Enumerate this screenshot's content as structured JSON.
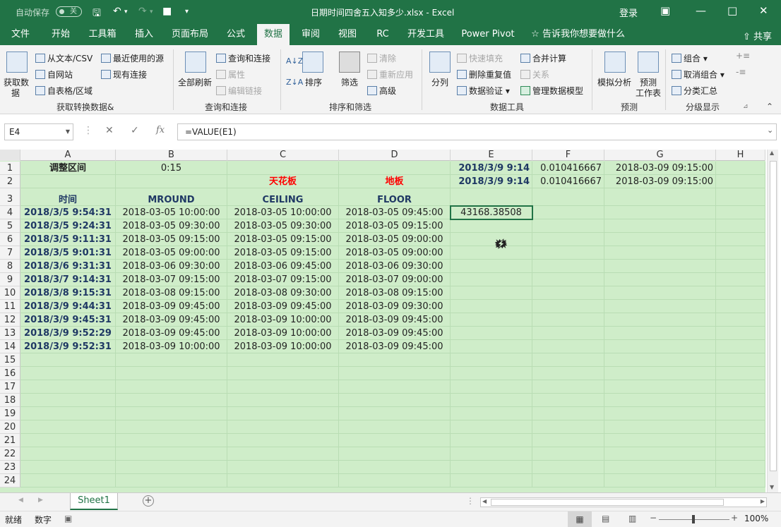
{
  "titlebar": {
    "autosave_label": "自动保存",
    "autosave_state": "关",
    "title": "日期时间四舍五入知多少.xlsx  -  Excel",
    "login": "登录"
  },
  "menu_tabs": [
    "文件",
    "开始",
    "工具箱",
    "插入",
    "页面布局",
    "公式",
    "数据",
    "审阅",
    "视图",
    "RC",
    "开发工具",
    "Power Pivot"
  ],
  "active_tab": "数据",
  "tell_me": "告诉我你想要做什么",
  "share": "共享",
  "ribbon": {
    "get_data": "获取数",
    "get_data2": "据",
    "from_text": "从文本/CSV",
    "from_web": "自网站",
    "from_table": "自表格/区域",
    "recent_sources": "最近使用的源",
    "existing_conn": "现有连接",
    "group_get": "获取转换数据&",
    "refresh_all": "全部刷新",
    "queries_conn": "查询和连接",
    "properties": "属性",
    "edit_links": "编辑链接",
    "group_query": "查询和连接",
    "sort": "排序",
    "filter": "筛选",
    "clear": "清除",
    "reapply": "重新应用",
    "advanced": "高级",
    "group_sort": "排序和筛选",
    "text_to_col": "分列",
    "flash_fill": "快速填充",
    "remove_dup": "删除重复值",
    "validation": "数据验证",
    "consolidate": "合并计算",
    "relationships": "关系",
    "manage_model": "管理数据模型",
    "group_tools": "数据工具",
    "whatif": "模拟分析",
    "forecast": "预测",
    "forecast2": "工作表",
    "group_forecast": "预测",
    "group_btn": "组合",
    "ungroup": "取消组合",
    "subtotal": "分类汇总",
    "group_outline": "分级显示"
  },
  "namebox": "E4",
  "formula": "=VALUE(E1)",
  "columns": [
    "A",
    "B",
    "C",
    "D",
    "E",
    "F",
    "G",
    "H"
  ],
  "rows": [
    "1",
    "2",
    "3",
    "4",
    "5",
    "6",
    "7",
    "8",
    "9",
    "10",
    "11",
    "12",
    "13",
    "14",
    "15",
    "16",
    "17",
    "18",
    "19",
    "20",
    "21",
    "22",
    "23",
    "24"
  ],
  "cells": {
    "A1": "调整区间",
    "B1": "0:15",
    "E1": "2018/3/9 9:14",
    "F1": "0.010416667",
    "G1": "2018-03-09 09:15:00",
    "C2": "天花板",
    "D2": "地板",
    "E2": "2018/3/9 9:14",
    "F2": "0.010416667",
    "G2": "2018-03-09 09:15:00",
    "A3": "时间",
    "B3": "MROUND",
    "C3": "CEILING",
    "D3": "FLOOR",
    "E4": "43168.38508",
    "data": [
      [
        "2018/3/5 9:54:31",
        "2018-03-05 10:00:00",
        "2018-03-05 10:00:00",
        "2018-03-05 09:45:00"
      ],
      [
        "2018/3/5 9:24:31",
        "2018-03-05 09:30:00",
        "2018-03-05 09:30:00",
        "2018-03-05 09:15:00"
      ],
      [
        "2018/3/5 9:11:31",
        "2018-03-05 09:15:00",
        "2018-03-05 09:15:00",
        "2018-03-05 09:00:00"
      ],
      [
        "2018/3/5 9:01:31",
        "2018-03-05 09:00:00",
        "2018-03-05 09:15:00",
        "2018-03-05 09:00:00"
      ],
      [
        "2018/3/6 9:31:31",
        "2018-03-06 09:30:00",
        "2018-03-06 09:45:00",
        "2018-03-06 09:30:00"
      ],
      [
        "2018/3/7 9:14:31",
        "2018-03-07 09:15:00",
        "2018-03-07 09:15:00",
        "2018-03-07 09:00:00"
      ],
      [
        "2018/3/8 9:15:31",
        "2018-03-08 09:15:00",
        "2018-03-08 09:30:00",
        "2018-03-08 09:15:00"
      ],
      [
        "2018/3/9 9:44:31",
        "2018-03-09 09:45:00",
        "2018-03-09 09:45:00",
        "2018-03-09 09:30:00"
      ],
      [
        "2018/3/9 9:45:31",
        "2018-03-09 09:45:00",
        "2018-03-09 10:00:00",
        "2018-03-09 09:45:00"
      ],
      [
        "2018/3/9 9:52:29",
        "2018-03-09 09:45:00",
        "2018-03-09 10:00:00",
        "2018-03-09 09:45:00"
      ],
      [
        "2018/3/9 9:52:31",
        "2018-03-09 10:00:00",
        "2018-03-09 10:00:00",
        "2018-03-09 09:45:00"
      ]
    ]
  },
  "sheet_tab": "Sheet1",
  "status": {
    "ready": "就绪",
    "mode": "数字",
    "zoom": "100%"
  },
  "colors": {
    "brand": "#217346",
    "cell_bg": "#cfedc9",
    "header_text": "#1f3864",
    "red_text": "#ff0000"
  }
}
